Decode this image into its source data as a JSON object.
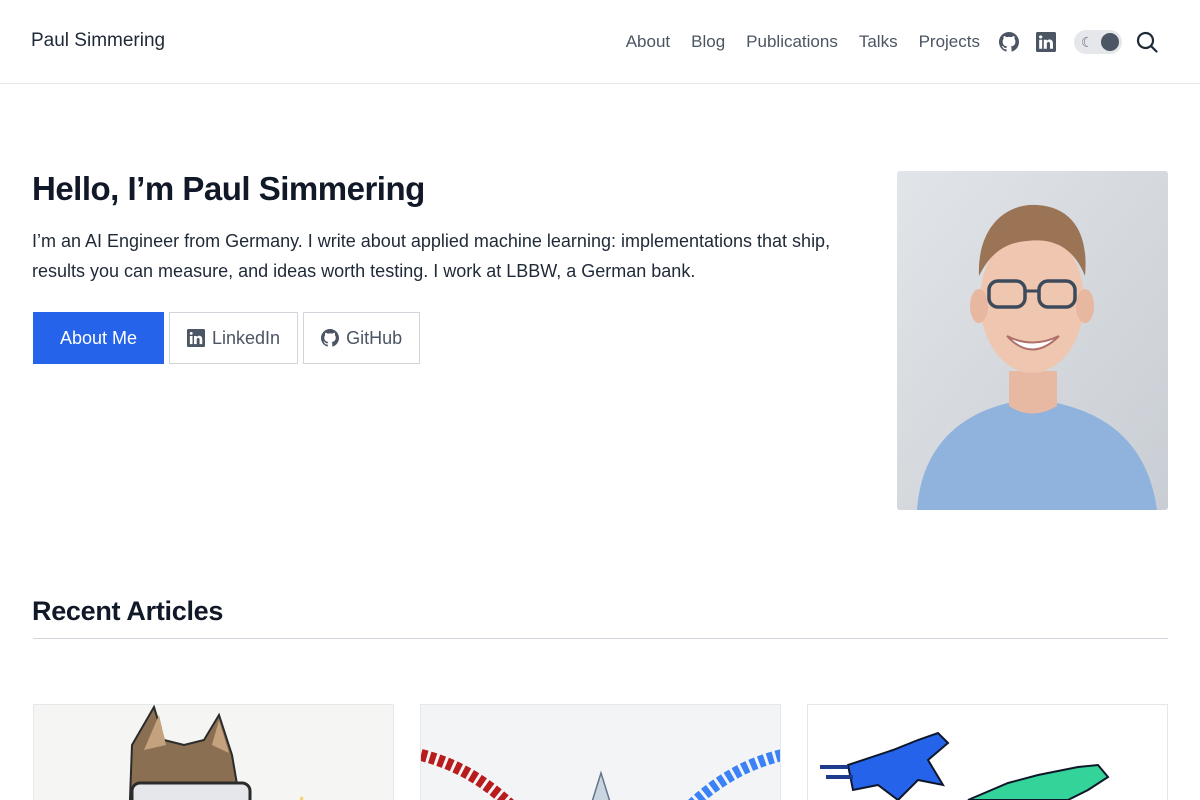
{
  "header": {
    "brand": "Paul Simmering",
    "nav": [
      "About",
      "Blog",
      "Publications",
      "Talks",
      "Projects"
    ],
    "icons": [
      "github-icon",
      "linkedin-icon",
      "theme-toggle",
      "search-icon"
    ]
  },
  "hero": {
    "title": "Hello, I’m Paul Simmering",
    "description": "I’m an AI Engineer from Germany. I write about applied machine learning: implementations that ship, results you can measure, and ideas worth testing. I work at LBBW, a German bank.",
    "buttons": {
      "about": "About Me",
      "linkedin": "LinkedIn",
      "github": "GitHub"
    }
  },
  "articles": {
    "heading": "Recent Articles"
  },
  "colors": {
    "accent": "#2563eb",
    "text": "#1f2937",
    "muted": "#4b5563",
    "border": "#e5e7eb"
  }
}
